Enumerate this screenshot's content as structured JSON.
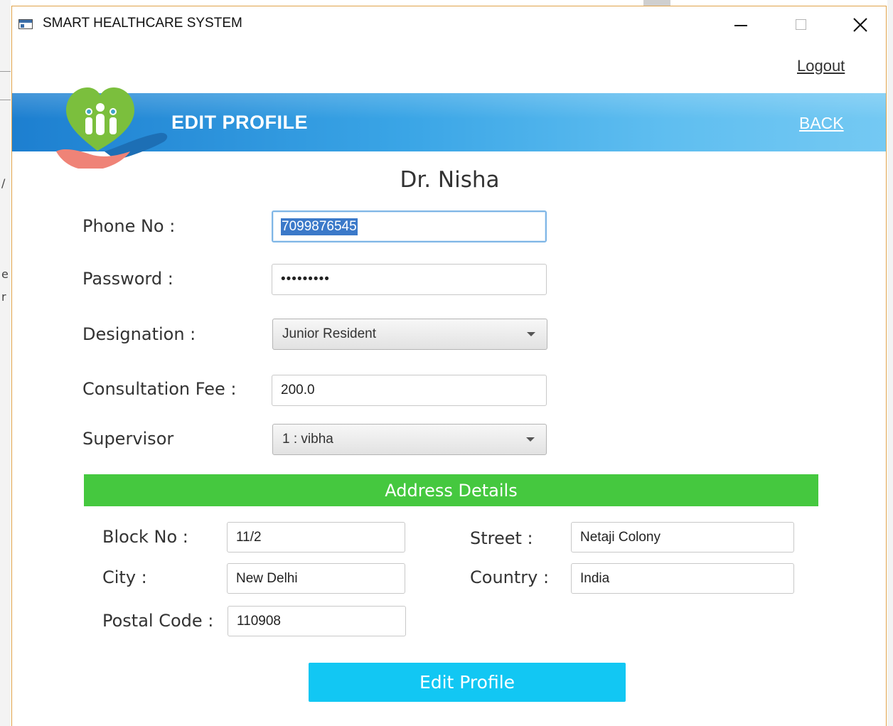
{
  "window": {
    "title": "SMART HEALTHCARE SYSTEM",
    "icons": {
      "minimize": "minimize-icon",
      "maximize": "maximize-icon",
      "close": "close-icon",
      "app": "app-window-icon"
    }
  },
  "header": {
    "logout": "Logout",
    "title": "EDIT PROFILE",
    "back": "BACK",
    "logo_icon": "healthcare-hands-heart-logo"
  },
  "profile": {
    "name": "Dr. Nisha",
    "phone_label": "Phone No :",
    "phone_value": "7099876545",
    "password_label": "Password :",
    "password_mask": "•••••••••",
    "designation_label": "Designation :",
    "designation_value": "Junior Resident",
    "fee_label": "Consultation Fee :",
    "fee_value": "200.0",
    "supervisor_label": "Supervisor",
    "supervisor_value": "1 : vibha"
  },
  "address": {
    "header": "Address Details",
    "block_label": "Block No :",
    "block_value": "11/2",
    "street_label": "Street :",
    "street_value": "Netaji Colony",
    "city_label": "City :",
    "city_value": "New Delhi",
    "country_label": "Country :",
    "country_value": "India",
    "postal_label": "Postal Code :",
    "postal_value": "110908"
  },
  "actions": {
    "edit_profile": "Edit Profile"
  },
  "colors": {
    "banner_start": "#1d7fd0",
    "banner_end": "#74c9f3",
    "address_header": "#45c83f",
    "primary_button": "#12c7f3",
    "window_border": "#e0a24a"
  }
}
